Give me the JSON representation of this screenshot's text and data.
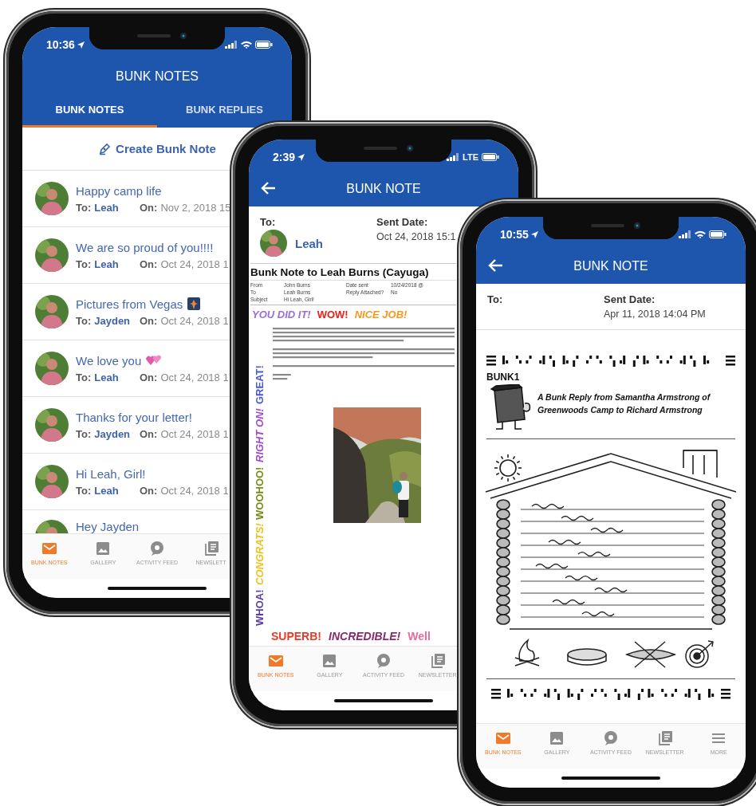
{
  "phones": [
    {
      "kind": "list",
      "status_bar": {
        "time": "10:36"
      },
      "header": {
        "title": "BUNK NOTES"
      },
      "tabs": [
        {
          "label": "BUNK NOTES",
          "selected": true
        },
        {
          "label": "BUNK REPLIES",
          "selected": false
        }
      ],
      "create_button": {
        "label": "Create Bunk Note"
      },
      "notes": [
        {
          "kind": "text",
          "subject": "Happy camp life",
          "to_label": "To:",
          "to": "Leah",
          "on_label": "On:",
          "date": "Nov 2, 2018 15"
        },
        {
          "kind": "text",
          "subject": "We are so proud of you!!!!",
          "to_label": "To:",
          "to": "Leah",
          "on_label": "On:",
          "date": "Oct 24, 2018 1"
        },
        {
          "kind": "photo-emoji",
          "subject": "Pictures from Vegas",
          "to_label": "To:",
          "to": "Jayden",
          "on_label": "On:",
          "date": "Oct 24, 2018 1"
        },
        {
          "kind": "hearts-emoji",
          "subject": "We love you",
          "to_label": "To:",
          "to": "Leah",
          "on_label": "On:",
          "date": "Oct 24, 2018 1"
        },
        {
          "kind": "text",
          "subject": "Thanks for your letter!",
          "to_label": "To:",
          "to": "Jayden",
          "on_label": "On:",
          "date": "Oct 24, 2018 1"
        },
        {
          "kind": "text",
          "subject": "Hi Leah, Girl!",
          "to_label": "To:",
          "to": "Leah",
          "on_label": "On:",
          "date": "Oct 24, 2018 1"
        },
        {
          "kind": "text",
          "subject": "Hey Jayden"
        }
      ],
      "bottom_nav": [
        {
          "label": "BUNK NOTES",
          "selected": true
        },
        {
          "label": "GALLERY",
          "selected": false
        },
        {
          "label": "ACTIVITY FEED",
          "selected": false
        },
        {
          "label": "NEWSLETT",
          "selected": false
        }
      ]
    },
    {
      "kind": "detail",
      "status_bar": {
        "time": "2:39",
        "carrier": "LTE"
      },
      "header": {
        "title": "BUNK NOTE"
      },
      "to": {
        "label": "To:",
        "name": "Leah"
      },
      "sent": {
        "label": "Sent Date:",
        "value": "Oct 24, 2018 15:1"
      },
      "document": {
        "kind": "note",
        "title": "Bunk Note to Leah Burns (Cayuga)",
        "meta": [
          {
            "label": "From",
            "value": "John Burns"
          },
          {
            "label": "Date sent",
            "value": "10/24/2018 @"
          },
          {
            "label": "To",
            "value": "Leah Burns"
          },
          {
            "label": "Reply Attached?",
            "value": "No"
          },
          {
            "label": "Subject",
            "value": "Hi Leah, Girl!"
          }
        ],
        "top_words": [
          {
            "text": "YOU DID IT!",
            "color": "#9b6fd6"
          },
          {
            "text": "WOW!",
            "color": "#e8231c"
          },
          {
            "text": "NICE JOB!",
            "color": "#f39a1e"
          }
        ],
        "side_words": [
          {
            "text": "WHOA!",
            "color": "#5b3fa6"
          },
          {
            "text": "CONGRATS!",
            "color": "#f2c21a"
          },
          {
            "text": "WOOHOO!",
            "color": "#7a8a1a"
          },
          {
            "text": "RIGHT ON!",
            "color": "#a04ad0"
          },
          {
            "text": "GREAT!",
            "color": "#4a5ad0"
          }
        ],
        "bottom_words": [
          {
            "text": "SUPERB!",
            "color": "#e83a2a"
          },
          {
            "text": "INCREDIBLE!",
            "color": "#8a2a6a"
          },
          {
            "text": "Well",
            "color": "#e86aa0"
          }
        ]
      },
      "bottom_nav": [
        {
          "label": "BUNK NOTES",
          "selected": true
        },
        {
          "label": "GALLERY",
          "selected": false
        },
        {
          "label": "ACTIVITY FEED",
          "selected": false
        },
        {
          "label": "NEWSLETTER",
          "selected": false
        }
      ]
    },
    {
      "kind": "detail",
      "status_bar": {
        "time": "10:55"
      },
      "header": {
        "title": "BUNK NOTE"
      },
      "to": {
        "label": "To:"
      },
      "sent": {
        "label": "Sent Date:",
        "value": "Apr 11, 2018 14:04 PM"
      },
      "document": {
        "kind": "scan",
        "logo": "BUNK1",
        "heading": "A Bunk Reply from Samantha Armstrong of Greenwoods Camp to Richard Armstrong"
      },
      "bottom_nav": [
        {
          "label": "BUNK NOTES",
          "selected": true
        },
        {
          "label": "GALLERY",
          "selected": false
        },
        {
          "label": "ACTIVITY FEED",
          "selected": false
        },
        {
          "label": "NEWSLETTER",
          "selected": false
        },
        {
          "label": "MORE",
          "selected": false
        }
      ]
    }
  ]
}
